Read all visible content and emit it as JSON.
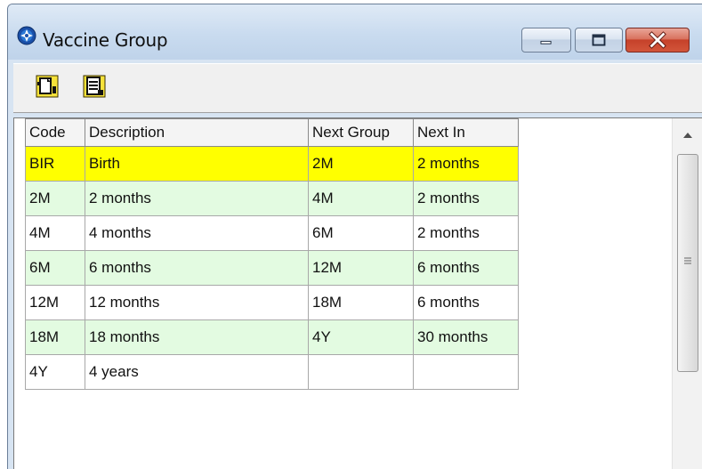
{
  "window": {
    "title": "Vaccine Group",
    "buttons": {
      "minimize": "minimize-icon",
      "maximize": "maximize-icon",
      "close": "close-icon"
    }
  },
  "toolbar": {
    "items": [
      {
        "icon": "new-record-icon"
      },
      {
        "icon": "edit-record-icon"
      }
    ]
  },
  "grid": {
    "columns": [
      "Code",
      "Description",
      "Next Group",
      "Next In"
    ],
    "rows": [
      {
        "code": "BIR",
        "description": "Birth",
        "next_group": "2M",
        "next_in": "2 months",
        "state": "selected"
      },
      {
        "code": "2M",
        "description": "2 months",
        "next_group": "4M",
        "next_in": "2 months",
        "state": "alt"
      },
      {
        "code": "4M",
        "description": "4 months",
        "next_group": "6M",
        "next_in": "2 months",
        "state": "plain"
      },
      {
        "code": "6M",
        "description": "6 months",
        "next_group": "12M",
        "next_in": "6 months",
        "state": "alt"
      },
      {
        "code": "12M",
        "description": "12 months",
        "next_group": "18M",
        "next_in": "6 months",
        "state": "plain"
      },
      {
        "code": "18M",
        "description": "18 months",
        "next_group": "4Y",
        "next_in": "30 months",
        "state": "alt"
      },
      {
        "code": "4Y",
        "description": "4 years",
        "next_group": "",
        "next_in": "",
        "state": "plain"
      }
    ]
  },
  "colors": {
    "selected_row": "#ffff00",
    "alt_row": "#e3fbe1",
    "plain_row": "#ffffff"
  }
}
